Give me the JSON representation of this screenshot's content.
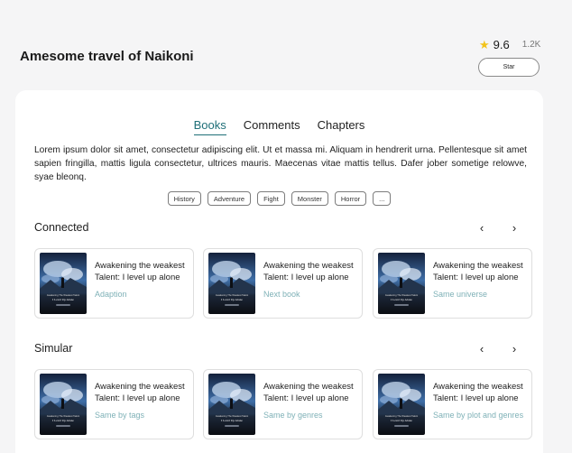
{
  "header": {
    "title": "Amesome travel of Naikoni",
    "rating": "9.6",
    "rating_count": "1.2K",
    "star_button": "Star",
    "star_color": "#f2c31a"
  },
  "tabs": [
    {
      "label": "Books",
      "active": true
    },
    {
      "label": "Comments",
      "active": false
    },
    {
      "label": "Chapters",
      "active": false
    }
  ],
  "accent_color": "#1f6f78",
  "description": "Lorem ipsum dolor sit amet, consectetur adipiscing elit. Ut et massa mi. Aliquam in hendrerit urna. Pellentesque sit amet sapien fringilla, mattis ligula consectetur, ultrices mauris. Maecenas vitae mattis tellus. Dafer jober sometige relowve, syae bleonq.",
  "tags": [
    "History",
    "Adventure",
    "Fight",
    "Monster",
    "Horror",
    "..."
  ],
  "sections": [
    {
      "title": "Connected",
      "prev_icon": "chevron-left-icon",
      "next_icon": "chevron-right-icon",
      "books": [
        {
          "title": "Awakening the weakest Talent: I level up alone",
          "tag": "Adaption"
        },
        {
          "title": "Awakening the weakest Talent: I level up alone",
          "tag": "Next book"
        },
        {
          "title": "Awakening the weakest Talent: I level up alone",
          "tag": "Same universe"
        }
      ]
    },
    {
      "title": "Simular",
      "prev_icon": "chevron-left-icon",
      "next_icon": "chevron-right-icon",
      "books": [
        {
          "title": "Awakening the weakest Talent: I level up alone",
          "tag": "Same by tags"
        },
        {
          "title": "Awakening the weakest Talent: I level up alone",
          "tag": "Same by genres"
        },
        {
          "title": "Awakening the weakest Talent: I level up alone",
          "tag": "Same by plot and genres"
        }
      ]
    }
  ],
  "cover": {
    "line1": "Awakening The Weakest Talent",
    "line2": "I Level Up Alone"
  }
}
